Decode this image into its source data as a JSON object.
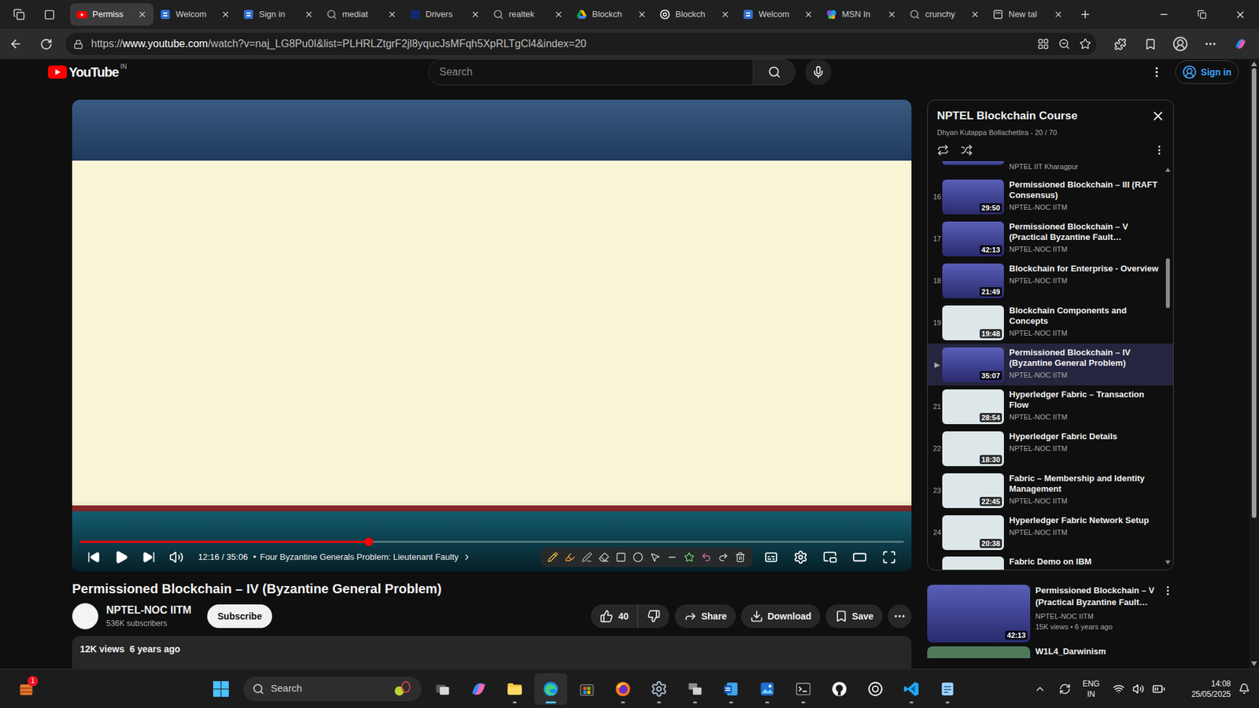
{
  "browser": {
    "tabs": [
      {
        "label": "Permiss",
        "kind": "youtube",
        "selected": true
      },
      {
        "label": "Welcom",
        "kind": "s",
        "selected": false
      },
      {
        "label": "Sign in",
        "kind": "s",
        "selected": false
      },
      {
        "label": "mediat",
        "kind": "search",
        "selected": false
      },
      {
        "label": "Drivers",
        "kind": "drivers",
        "selected": false
      },
      {
        "label": "realtek",
        "kind": "search",
        "selected": false
      },
      {
        "label": "Blockch",
        "kind": "drive",
        "selected": false
      },
      {
        "label": "Blockch",
        "kind": "openai",
        "selected": false
      },
      {
        "label": "Welcom",
        "kind": "s",
        "selected": false
      },
      {
        "label": "MSN In",
        "kind": "msn",
        "selected": false
      },
      {
        "label": "crunchy",
        "kind": "search",
        "selected": false
      },
      {
        "label": "New tal",
        "kind": "newtab",
        "selected": false
      }
    ],
    "address": {
      "scheme": "https://",
      "host": "www.youtube.com",
      "path": "/watch?v=naj_LG8Pu0I&list=PLHRLZtgrF2jl8yqucJsMFqh5XpRLTgCl4&index=20"
    }
  },
  "youtube": {
    "logo": {
      "text": "YouTube",
      "region": "IN"
    },
    "search": {
      "placeholder": "Search"
    },
    "sign_in": "Sign in",
    "player": {
      "time": "12:16 / 35:06",
      "bullet": "•",
      "chapter": "Four Byzantine Generals Problem: Lieutenant Faulty",
      "progress": {
        "level": 0.35
      },
      "playing": false,
      "muted": false
    },
    "video": {
      "title": "Permissioned Blockchain – IV (Byzantine General Problem)",
      "channel": "NPTEL-NOC IITM",
      "subscribers": "536K subscribers",
      "subscribe": "Subscribe",
      "likes": "40",
      "liked": false,
      "actions": [
        {
          "label": "Share",
          "kind": "share"
        },
        {
          "label": "Download",
          "kind": "download"
        },
        {
          "label": "Save",
          "kind": "save"
        }
      ],
      "views": "12K views",
      "age": "6 years ago"
    },
    "playlist": {
      "title": "NPTEL Blockchain Course",
      "subtitle": "Dhyan Kutappa Bollachettira - 20 / 70",
      "loop": false,
      "shuffle": false,
      "scrollbar": {
        "position": 0.22,
        "size": 0.13
      },
      "items": [
        {
          "kind": "head",
          "thumb": "photo",
          "channel": "NPTEL IIT Kharagpur",
          "selected": false
        },
        {
          "kind": "full",
          "thumb": "photo",
          "index": "16",
          "title": "Permissioned Blockchain – III (RAFT Consensus)",
          "channel": "NPTEL-NOC IITM",
          "duration": "29:50",
          "selected": false
        },
        {
          "kind": "full",
          "thumb": "photo",
          "index": "17",
          "title": "Permissioned Blockchain – V (Practical Byzantine Fault…",
          "channel": "NPTEL-NOC IITM",
          "duration": "42:13",
          "selected": false
        },
        {
          "kind": "full",
          "thumb": "photo",
          "index": "18",
          "title": "Blockchain for Enterprise - Overview",
          "channel": "NPTEL-NOC IITM",
          "duration": "21:49",
          "selected": false
        },
        {
          "kind": "full",
          "thumb": "slides",
          "index": "19",
          "title": "Blockchain Components and Concepts",
          "channel": "NPTEL-NOC IITM",
          "duration": "19:48",
          "selected": false
        },
        {
          "kind": "full",
          "thumb": "photo",
          "index": "▶",
          "title": "Permissioned Blockchain – IV (Byzantine General Problem)",
          "channel": "NPTEL-NOC IITM",
          "duration": "35:07",
          "selected": true
        },
        {
          "kind": "full",
          "thumb": "slides",
          "index": "21",
          "title": "Hyperledger Fabric – Transaction Flow",
          "channel": "NPTEL-NOC IITM",
          "duration": "28:54",
          "selected": false
        },
        {
          "kind": "full",
          "thumb": "slides",
          "index": "22",
          "title": "Hyperledger Fabric Details",
          "channel": "NPTEL-NOC IITM",
          "duration": "18:30",
          "selected": false
        },
        {
          "kind": "full",
          "thumb": "slides",
          "index": "23",
          "title": "Fabric – Membership and Identity Management",
          "channel": "NPTEL-NOC IITM",
          "duration": "22:45",
          "selected": false
        },
        {
          "kind": "full",
          "thumb": "slides",
          "index": "24",
          "title": "Hyperledger Fabric Network Setup",
          "channel": "NPTEL-NOC IITM",
          "duration": "20:38",
          "selected": false
        },
        {
          "kind": "tail",
          "thumb": "slides",
          "title": "Fabric Demo on IBM",
          "selected": false
        }
      ]
    },
    "up_next": [
      {
        "kind": "full",
        "title": "Permissioned Blockchain – V (Practical Byzantine Fault…",
        "channel": "NPTEL-NOC IITM",
        "meta": "15K views • 6 years ago",
        "duration": "42:13"
      },
      {
        "kind": "tail",
        "title": "W1L4_Darwinism"
      }
    ],
    "scrollbar": {
      "position": 0.0,
      "size": 0.76
    }
  },
  "taskbar": {
    "widgets": {
      "badge": "1"
    },
    "search": {
      "placeholder": "Search"
    },
    "apps": [
      {
        "kind": "taskview",
        "running": false,
        "active": false
      },
      {
        "kind": "copilot",
        "running": false,
        "active": false
      },
      {
        "kind": "explorer",
        "running": true,
        "active": false
      },
      {
        "kind": "edge",
        "running": true,
        "active": true
      },
      {
        "kind": "store",
        "running": false,
        "active": false
      },
      {
        "kind": "firefox",
        "running": true,
        "active": false
      },
      {
        "kind": "settings",
        "running": true,
        "active": false
      },
      {
        "kind": "devices",
        "running": true,
        "active": false
      },
      {
        "kind": "word",
        "running": true,
        "active": false
      },
      {
        "kind": "photos",
        "running": true,
        "active": false
      },
      {
        "kind": "terminal",
        "running": true,
        "active": false
      },
      {
        "kind": "github",
        "running": false,
        "active": false
      },
      {
        "kind": "chatgpt",
        "running": false,
        "active": false
      },
      {
        "kind": "vscode",
        "running": true,
        "active": false
      },
      {
        "kind": "notepad",
        "running": true,
        "active": false
      }
    ],
    "tray": {
      "language": "ENG",
      "region": "IN",
      "time": "14:08",
      "date": "25/05/2025"
    }
  }
}
